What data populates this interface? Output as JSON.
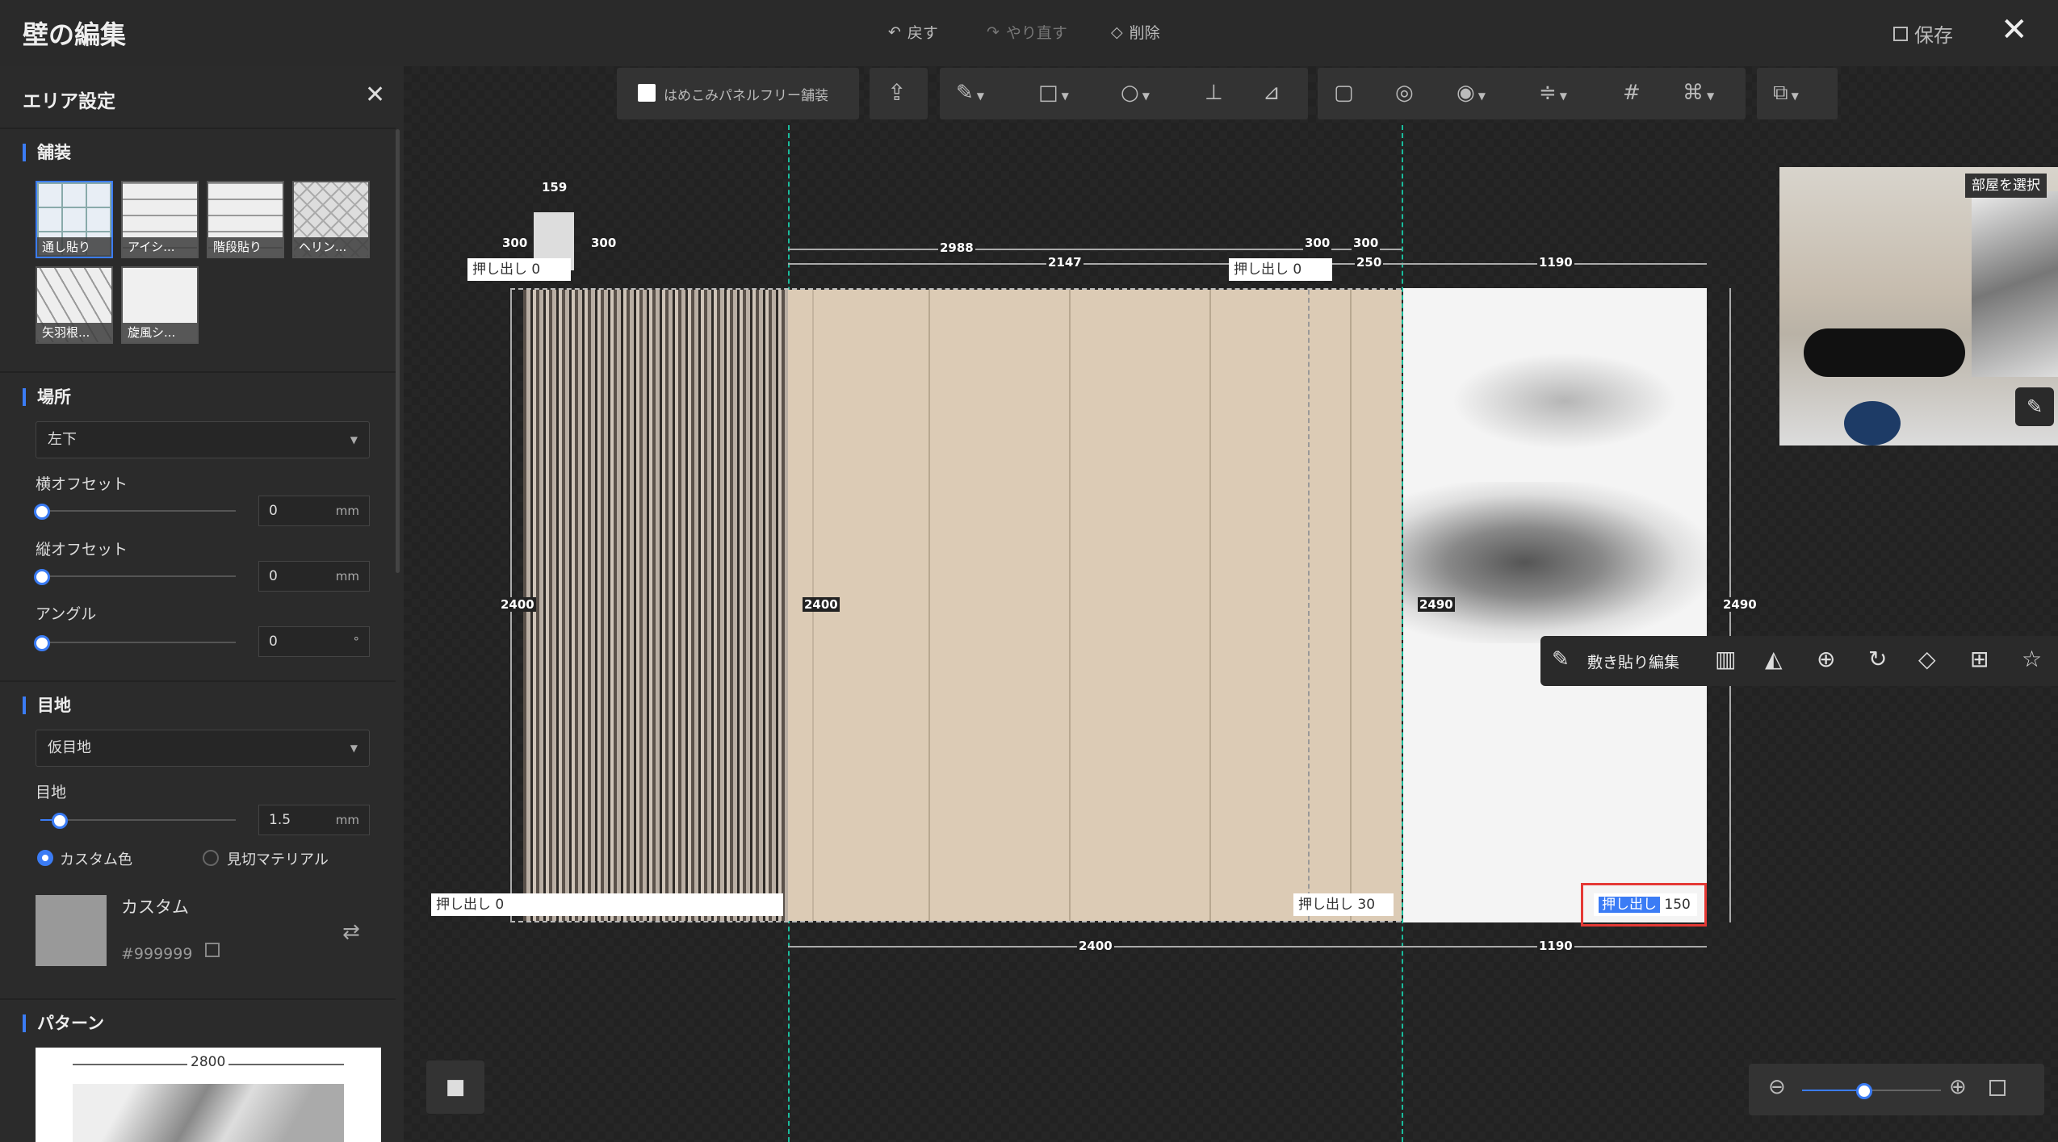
{
  "header": {
    "title": "壁の編集",
    "undo_label": "戻す",
    "redo_label": "やり直す",
    "delete_label": "削除",
    "save_label": "保存"
  },
  "left_panel": {
    "title": "エリア設定",
    "paving": {
      "heading": "舗装",
      "patterns": [
        "通し貼り",
        "アイシ...",
        "階段貼り",
        "ヘリン...",
        "矢羽根...",
        "旋風シ..."
      ]
    },
    "location": {
      "heading": "場所",
      "anchor_value": "左下",
      "h_offset_label": "横オフセット",
      "h_offset_value": "0",
      "h_offset_unit": "mm",
      "v_offset_label": "縦オフセット",
      "v_offset_value": "0",
      "v_offset_unit": "mm",
      "angle_label": "アングル",
      "angle_value": "0",
      "angle_unit": "°"
    },
    "joint": {
      "heading": "目地",
      "type_value": "仮目地",
      "width_label": "目地",
      "width_value": "1.5",
      "width_unit": "mm",
      "width_slider_fraction": 0.1,
      "radio_custom_label": "カスタム色",
      "radio_material_label": "見切マテリアル",
      "color_name": "カスタム",
      "color_hex": "#999999"
    },
    "pattern": {
      "heading": "パターン",
      "dimension": "2800"
    }
  },
  "toolbar": {
    "embed_checkbox_label": "はめこみパネルフリー舗装"
  },
  "canvas": {
    "dims": {
      "d159": "159",
      "d300a": "300",
      "d300b": "300",
      "d300c": "300",
      "d300d": "300",
      "d2988": "2988",
      "d2147": "2147",
      "d250": "250",
      "d1190_top": "1190",
      "d2400": "2400",
      "d1190_bottom": "1190",
      "d2490_mid": "2490",
      "d2490_right": "2490",
      "d2400_repeat": "2400"
    },
    "push_labels": [
      {
        "label": "押し出し",
        "value": "0"
      },
      {
        "label": "押し出し",
        "value": "0"
      },
      {
        "label": "押し出し",
        "value": "0"
      },
      {
        "label": "押し出し",
        "value": "30"
      },
      {
        "label": "押し出し",
        "value": "150"
      }
    ]
  },
  "preview": {
    "select_room_label": "部屋を選択"
  },
  "float_toolbar": {
    "edit_label": "敷き貼り編集"
  },
  "zoom": {
    "level_fraction": 0.45
  },
  "colors": {
    "accent": "#3b7cf5",
    "guide": "#1abc9c",
    "highlight": "#e53935",
    "joint_color": "#999999"
  }
}
